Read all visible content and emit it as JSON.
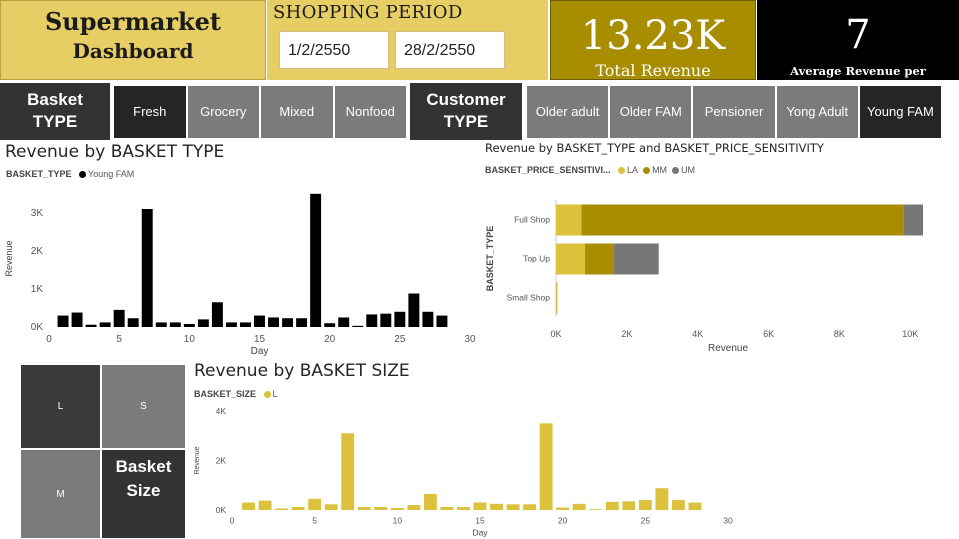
{
  "header": {
    "title_line1": "Supermarket",
    "title_line2": "Dashboard",
    "period_title": "SHOPPING PERIOD",
    "date_start": "1/2/2550",
    "date_end": "28/2/2550"
  },
  "kpis": {
    "total_revenue_value": "13.23K",
    "total_revenue_label": "Total Revenue",
    "avg_value": "7",
    "avg_label": "Average Revenue per Customer"
  },
  "basket_slicer": {
    "label_line1": "Basket",
    "label_line2": "TYPE",
    "options": [
      "Fresh",
      "Grocery",
      "Mixed",
      "Nonfood"
    ],
    "selected": "Fresh"
  },
  "customer_slicer": {
    "label_line1": "Customer",
    "label_line2": "TYPE",
    "options": [
      "Older adult",
      "Older FAM",
      "Pensioner",
      "Yong Adult",
      "Young FAM"
    ],
    "selected": "Young FAM"
  },
  "basket_size": {
    "tiles": [
      "L",
      "S",
      "M"
    ],
    "label_line1": "Basket",
    "label_line2": "Size"
  },
  "colors": {
    "gold_light": "#e6cd64",
    "gold_dark": "#a88d00",
    "bar_black": "#000000",
    "la": "#dcc13c",
    "mm": "#a88d00",
    "um": "#777777",
    "bar_yellow": "#dcc13c"
  },
  "chart_data": [
    {
      "type": "bar",
      "title": "Revenue by BASKET TYPE",
      "legend_title": "BASKET_TYPE",
      "xlabel": "Day",
      "ylabel": "Revenue",
      "xlim": [
        0,
        30
      ],
      "ylim": [
        0,
        3600
      ],
      "x_ticks": [
        0,
        5,
        10,
        15,
        20,
        25,
        30
      ],
      "y_ticks": [
        0,
        1000,
        2000,
        3000
      ],
      "y_tick_labels": [
        "0K",
        "1K",
        "2K",
        "3K"
      ],
      "series": [
        {
          "name": "Young FAM",
          "x": [
            1,
            2,
            3,
            4,
            5,
            6,
            7,
            8,
            9,
            10,
            11,
            12,
            13,
            14,
            15,
            16,
            17,
            18,
            19,
            20,
            21,
            22,
            23,
            24,
            25,
            26,
            27,
            28
          ],
          "values": [
            300,
            380,
            60,
            120,
            450,
            230,
            3100,
            120,
            120,
            80,
            200,
            650,
            120,
            120,
            300,
            250,
            230,
            230,
            3500,
            100,
            250,
            30,
            330,
            350,
            400,
            880,
            400,
            300
          ]
        }
      ]
    },
    {
      "type": "bar",
      "orientation": "horizontal",
      "stacked": true,
      "title": "Revenue by BASKET_TYPE and BASKET_PRICE_SENSITIVITY",
      "legend_title": "BASKET_PRICE_SENSITIVI...",
      "categories": [
        "Full Shop",
        "Top Up",
        "Small Shop"
      ],
      "xlabel": "Revenue",
      "ylabel": "BASKET_TYPE",
      "xlim": [
        0,
        10500
      ],
      "x_ticks": [
        0,
        2000,
        4000,
        6000,
        8000,
        10000
      ],
      "x_tick_labels": [
        "0K",
        "2K",
        "4K",
        "6K",
        "8K",
        "10K"
      ],
      "series": [
        {
          "name": "LA",
          "values": [
            720,
            820,
            20
          ]
        },
        {
          "name": "MM",
          "values": [
            9100,
            820,
            15
          ]
        },
        {
          "name": "UM",
          "values": [
            540,
            1260,
            0
          ]
        }
      ]
    },
    {
      "type": "bar",
      "title": "Revenue by BASKET SIZE",
      "legend_title": "BASKET_SIZE",
      "xlabel": "Day",
      "ylabel": "Revenue",
      "xlim": [
        0,
        30
      ],
      "ylim": [
        0,
        4000
      ],
      "x_ticks": [
        0,
        5,
        10,
        15,
        20,
        25,
        30
      ],
      "y_ticks": [
        0,
        2000,
        4000
      ],
      "y_tick_labels": [
        "0K",
        "2K",
        "4K"
      ],
      "series": [
        {
          "name": "L",
          "x": [
            1,
            2,
            3,
            4,
            5,
            6,
            7,
            8,
            9,
            10,
            11,
            12,
            13,
            14,
            15,
            16,
            17,
            18,
            19,
            20,
            21,
            22,
            23,
            24,
            25,
            26,
            27,
            28
          ],
          "values": [
            300,
            380,
            60,
            120,
            450,
            230,
            3100,
            120,
            120,
            80,
            200,
            650,
            120,
            120,
            300,
            250,
            230,
            230,
            3500,
            100,
            250,
            30,
            330,
            350,
            400,
            880,
            400,
            300
          ]
        }
      ]
    }
  ]
}
